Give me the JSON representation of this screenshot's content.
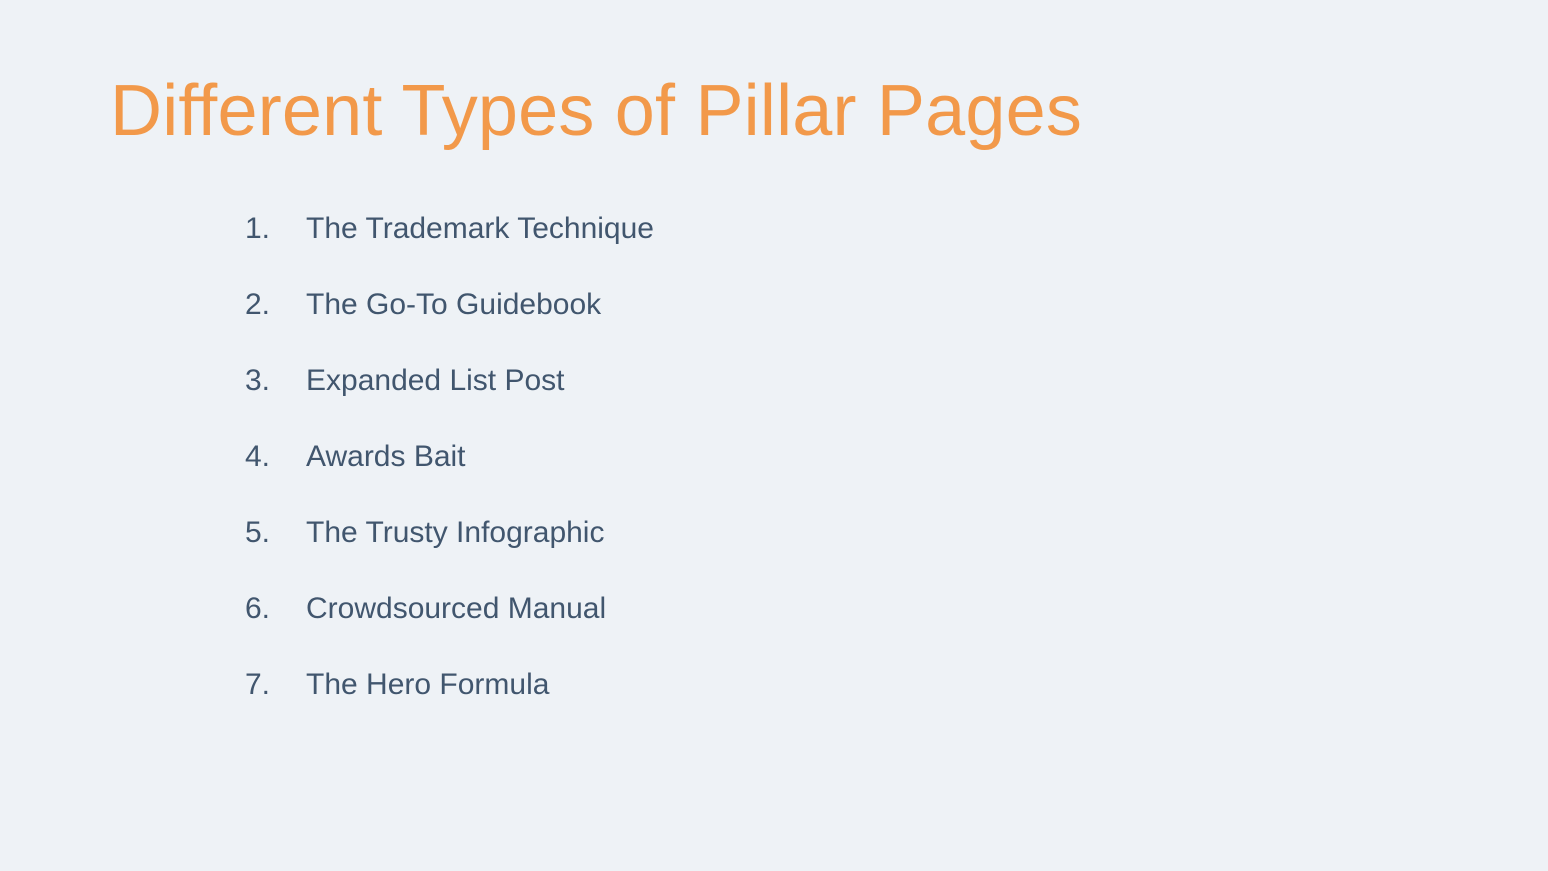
{
  "title": "Different Types of Pillar Pages",
  "items": [
    "The Trademark Technique",
    "The Go-To Guidebook",
    "Expanded List Post",
    "Awards Bait",
    "The Trusty Infographic",
    "Crowdsourced Manual",
    "The Hero Formula"
  ]
}
